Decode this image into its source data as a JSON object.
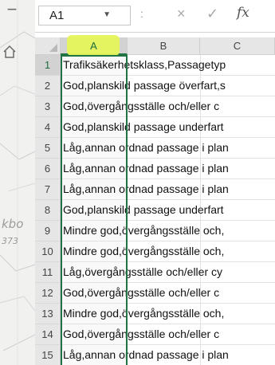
{
  "formula_bar": {
    "name_box": "A1",
    "dots": ":",
    "cancel_icon": "×",
    "enter_icon": "✓",
    "fx_label": "fx"
  },
  "columns": [
    "A",
    "B",
    "C"
  ],
  "selected_column": "A",
  "highlight_color": "#e5f55b",
  "selection_color": "#217346",
  "rows": [
    {
      "num": "1",
      "text": "Trafiksäkerhetsklass,Passagetyp"
    },
    {
      "num": "2",
      "text": "God,planskild passage överfart,s"
    },
    {
      "num": "3",
      "text": "God,övergångsställe och/eller c"
    },
    {
      "num": "4",
      "text": "God,planskild passage underfart"
    },
    {
      "num": "5",
      "text": "Låg,annan ordnad passage i plan"
    },
    {
      "num": "6",
      "text": "Låg,annan ordnad passage i plan"
    },
    {
      "num": "7",
      "text": "Låg,annan ordnad passage i plan"
    },
    {
      "num": "8",
      "text": "God,planskild passage underfart"
    },
    {
      "num": "9",
      "text": "Mindre god,övergångsställe och,"
    },
    {
      "num": "10",
      "text": "Mindre god,övergångsställe och,"
    },
    {
      "num": "11",
      "text": "Låg,övergångsställe och/eller cy"
    },
    {
      "num": "12",
      "text": "God,övergångsställe och/eller c"
    },
    {
      "num": "13",
      "text": "Mindre god,övergångsställe och,"
    },
    {
      "num": "14",
      "text": "God,övergångsställe och/eller c"
    },
    {
      "num": "15",
      "text": "Låg,annan ordnad passage i plan"
    }
  ],
  "map": {
    "label_large": "kbo",
    "label_small": "373"
  }
}
